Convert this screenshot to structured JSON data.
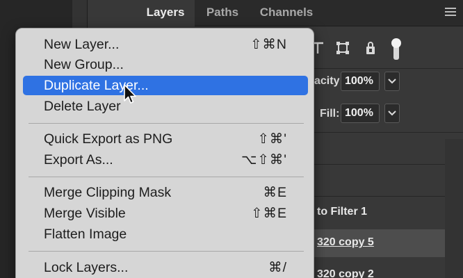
{
  "layers_panel": {
    "tabs": [
      {
        "label": "Layers",
        "active": true
      },
      {
        "label": "Paths",
        "active": false
      },
      {
        "label": "Channels",
        "active": false
      }
    ],
    "opacity_label": "acity:",
    "opacity_value": "100%",
    "fill_label": "Fill:",
    "fill_value": "100%",
    "layers": [
      {
        "name": "to Filter 1",
        "selected": false
      },
      {
        "name": "320 copy 5",
        "selected": true
      },
      {
        "name": "320 copy 2",
        "selected": false
      }
    ]
  },
  "context_menu": {
    "items": [
      {
        "label": "New Layer...",
        "shortcut": "⇧⌘N",
        "highlighted": false
      },
      {
        "label": "New Group...",
        "shortcut": "",
        "highlighted": false
      },
      {
        "label": "Duplicate Layer...",
        "shortcut": "",
        "highlighted": true
      },
      {
        "label": "Delete Layer",
        "shortcut": "",
        "highlighted": false
      },
      {
        "label": "Quick Export as PNG",
        "shortcut": "⇧⌘'",
        "highlighted": false
      },
      {
        "label": "Export As...",
        "shortcut": "⌥⇧⌘'",
        "highlighted": false
      },
      {
        "label": "Merge Clipping Mask",
        "shortcut": "⌘E",
        "highlighted": false
      },
      {
        "label": "Merge Visible",
        "shortcut": "⇧⌘E",
        "highlighted": false
      },
      {
        "label": "Flatten Image",
        "shortcut": "",
        "highlighted": false
      },
      {
        "label": "Lock Layers...",
        "shortcut": "⌘/",
        "highlighted": false
      }
    ]
  },
  "colors": {
    "menu_highlight": "#2f72e3",
    "menu_background": "#d6d6d6",
    "panel_background": "#383838"
  }
}
